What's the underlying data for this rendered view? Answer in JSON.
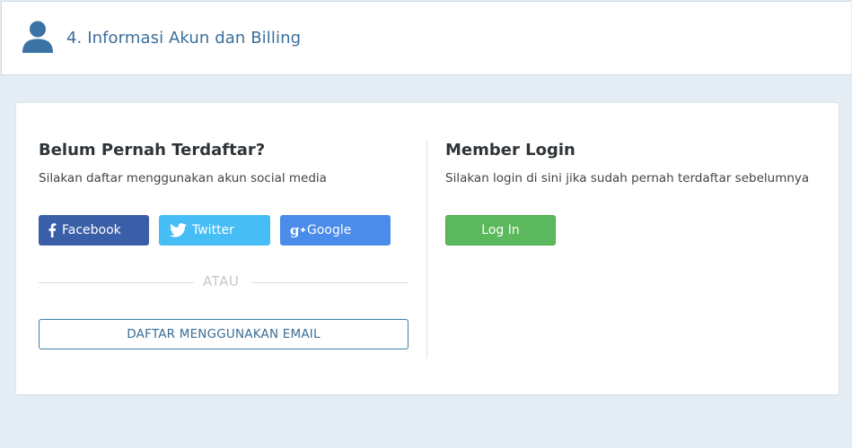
{
  "header": {
    "title": "4. Informasi Akun dan Billing",
    "icon": "user-icon"
  },
  "register": {
    "heading": "Belum Pernah Terdaftar?",
    "subtitle": "Silakan daftar menggunakan akun social media",
    "facebook_label": "Facebook",
    "twitter_label": "Twitter",
    "google_label": "Google",
    "or_label": "ATAU",
    "email_button_label": "DAFTAR MENGGUNAKAN EMAIL"
  },
  "login": {
    "heading": "Member Login",
    "subtitle": "Silakan login di sini jika sudah pernah terdaftar sebelumnya",
    "button_label": "Log In"
  },
  "colors": {
    "facebook": "#3b5ea8",
    "twitter": "#47bdf6",
    "google": "#4b8bea",
    "login": "#5cb85c",
    "header_title": "#3a6e9c",
    "background": "#e3edf3"
  }
}
